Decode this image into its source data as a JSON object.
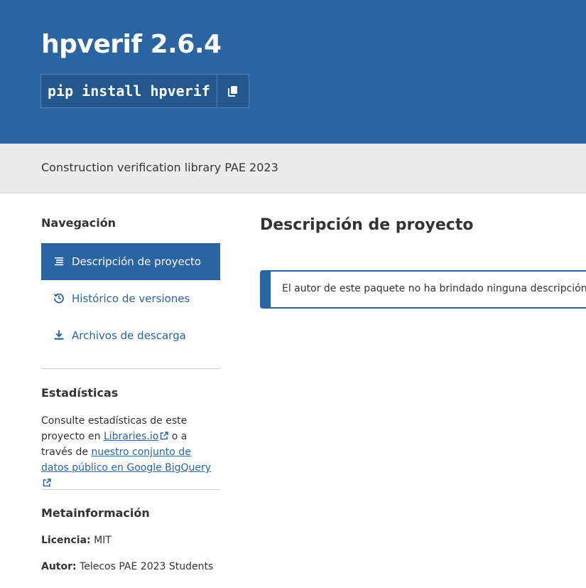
{
  "header": {
    "title": "hpverif 2.6.4",
    "pip_command": "pip install hpverif",
    "copy_icon": "copy-icon"
  },
  "summary": "Construction verification library PAE 2023",
  "sidebar": {
    "nav_heading": "Navegación",
    "nav_items": [
      {
        "label": "Descripción de proyecto",
        "icon": "align-left-icon",
        "active": true
      },
      {
        "label": "Histórico de versiones",
        "icon": "history-icon",
        "active": false
      },
      {
        "label": "Archivos de descarga",
        "icon": "download-icon",
        "active": false
      }
    ],
    "stats_heading": "Estadísticas",
    "stats": {
      "text_before": "Consulte estadísticas de este proyecto en ",
      "link1": "Libraries.io",
      "text_middle": " o a través de ",
      "link2": "nuestro conjunto de datos público en Google BigQuery"
    },
    "meta_heading": "Metainformación",
    "license_label": "Licencia:",
    "license_value": " MIT",
    "author_label": "Autor:",
    "author_value": " Telecos PAE 2023 Students"
  },
  "main": {
    "heading": "Descripción de proyecto",
    "notice": "El autor de este paquete no ha brindado ninguna descripción para el proyecto"
  },
  "colors": {
    "brand_blue": "#2a64a3",
    "subbar_gray": "#ececec"
  }
}
